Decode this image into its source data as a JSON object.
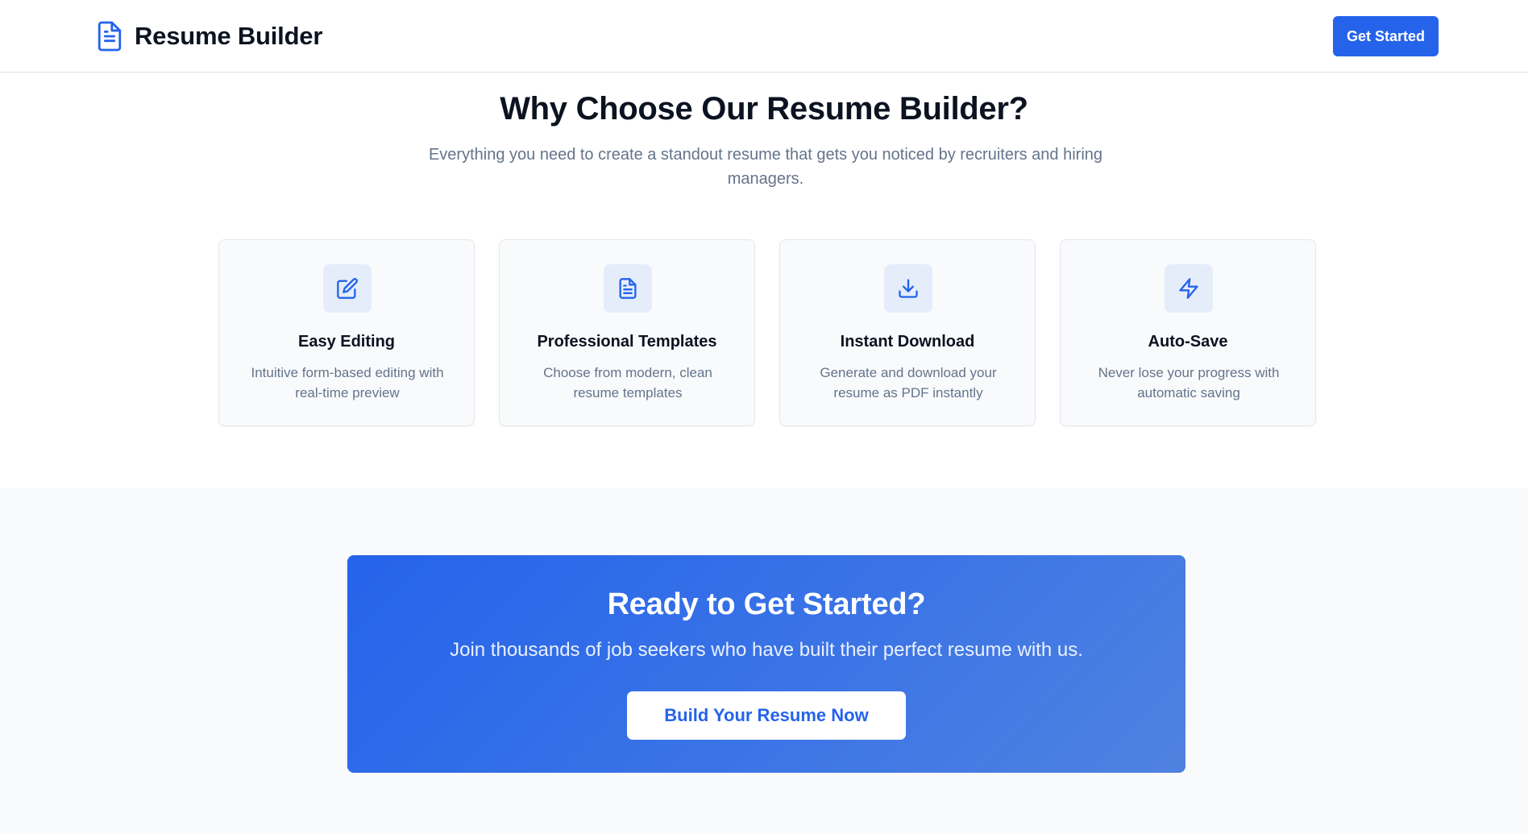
{
  "header": {
    "brand_name": "Resume Builder",
    "brand_icon": "document-icon",
    "cta_label": "Get Started"
  },
  "features": {
    "title": "Why Choose Our Resume Builder?",
    "subtitle": "Everything you need to create a standout resume that gets you noticed by recruiters and hiring managers.",
    "cards": [
      {
        "icon": "edit-icon",
        "title": "Easy Editing",
        "description": "Intuitive form-based editing with real-time preview"
      },
      {
        "icon": "document-icon",
        "title": "Professional Templates",
        "description": "Choose from modern, clean resume templates"
      },
      {
        "icon": "download-icon",
        "title": "Instant Download",
        "description": "Generate and download your resume as PDF instantly"
      },
      {
        "icon": "lightning-icon",
        "title": "Auto-Save",
        "description": "Never lose your progress with automatic saving"
      }
    ]
  },
  "cta": {
    "title": "Ready to Get Started?",
    "subtitle": "Join thousands of job seekers who have built their perfect resume with us.",
    "button_label": "Build Your Resume Now"
  },
  "colors": {
    "accent": "#2563eb",
    "icon_tile": "#e5edfb",
    "muted_text": "#64748b",
    "heading_text": "#0b1220",
    "page_background": "#f8fafc"
  }
}
